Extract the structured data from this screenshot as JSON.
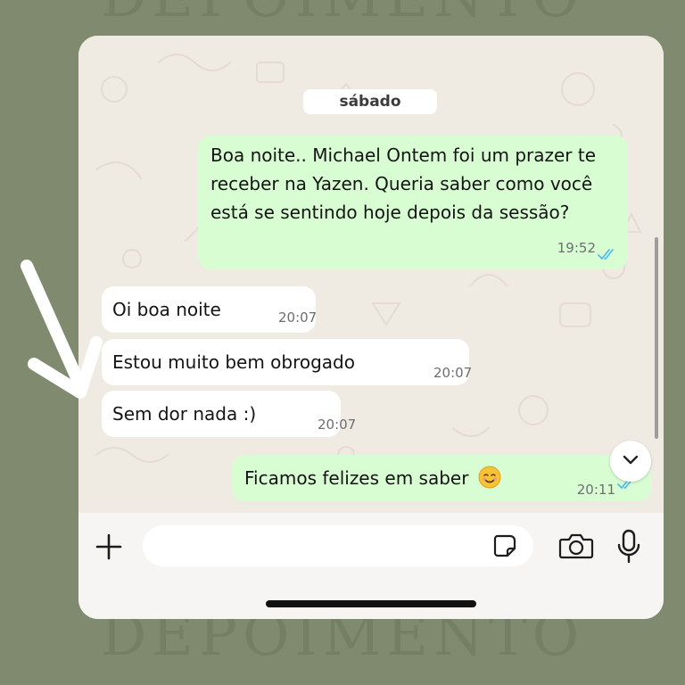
{
  "watermark": {
    "text": "DEPOIMENTO"
  },
  "chat": {
    "day_label": "sábado",
    "messages": [
      {
        "direction": "out",
        "text": "Boa noite.. Michael Ontem foi um prazer te receber na Yazen. Queria saber como você está se sentindo hoje depois da sessão?",
        "time": "19:52",
        "status": "read"
      },
      {
        "direction": "in",
        "text": "Oi boa noite",
        "time": "20:07"
      },
      {
        "direction": "in",
        "text": "Estou muito bem obrogado",
        "time": "20:07"
      },
      {
        "direction": "in",
        "text": "Sem dor nada :)",
        "time": "20:07"
      },
      {
        "direction": "out",
        "text": "Ficamos felizes em saber",
        "emoji": "smiling-face-emoji",
        "time": "20:11",
        "status": "read"
      }
    ]
  },
  "input": {
    "placeholder": "",
    "value": ""
  },
  "icons": {
    "attach": "plus-icon",
    "sticker": "sticker-icon",
    "camera": "camera-icon",
    "mic": "microphone-icon",
    "scroll": "chevron-down-icon",
    "read_receipt": "double-check-icon"
  },
  "colors": {
    "background": "#7f8a6e",
    "outgoing_bubble": "#d9fdd3",
    "incoming_bubble": "#ffffff",
    "chat_background": "#efeae2",
    "read_tick": "#53bdeb"
  }
}
